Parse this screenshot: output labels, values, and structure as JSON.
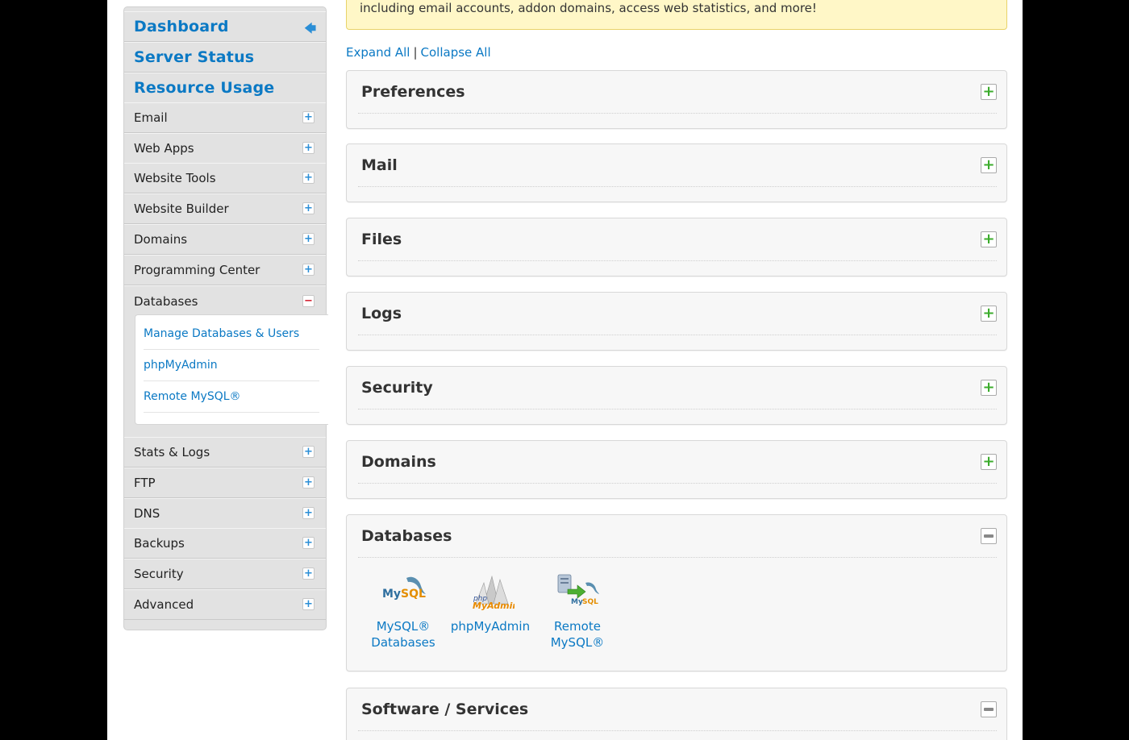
{
  "sidebar": {
    "top_links": [
      {
        "label": "Dashboard",
        "icon": "back-arrow-icon"
      },
      {
        "label": "Server Status"
      },
      {
        "label": "Resource Usage"
      }
    ],
    "sections": [
      {
        "label": "Email",
        "state": "collapsed"
      },
      {
        "label": "Web Apps",
        "state": "collapsed"
      },
      {
        "label": "Website Tools",
        "state": "collapsed"
      },
      {
        "label": "Website Builder",
        "state": "collapsed"
      },
      {
        "label": "Domains",
        "state": "collapsed"
      },
      {
        "label": "Programming Center",
        "state": "collapsed"
      },
      {
        "label": "Databases",
        "state": "expanded"
      },
      {
        "label": "Stats & Logs",
        "state": "collapsed"
      },
      {
        "label": "FTP",
        "state": "collapsed"
      },
      {
        "label": "DNS",
        "state": "collapsed"
      },
      {
        "label": "Backups",
        "state": "collapsed"
      },
      {
        "label": "Security",
        "state": "collapsed"
      },
      {
        "label": "Advanced",
        "state": "collapsed"
      }
    ],
    "databases_sublinks": [
      "Manage Databases & Users",
      "phpMyAdmin",
      "Remote MySQL®"
    ]
  },
  "main": {
    "notice_text": "including email accounts, addon domains, access web statistics, and more!",
    "expand_all": "Expand All",
    "separator": "|",
    "collapse_all": "Collapse All",
    "groups": [
      {
        "title": "Preferences",
        "state": "collapsed"
      },
      {
        "title": "Mail",
        "state": "collapsed"
      },
      {
        "title": "Files",
        "state": "collapsed"
      },
      {
        "title": "Logs",
        "state": "collapsed"
      },
      {
        "title": "Security",
        "state": "collapsed"
      },
      {
        "title": "Domains",
        "state": "collapsed"
      },
      {
        "title": "Databases",
        "state": "expanded",
        "apps": [
          {
            "label_line1": "MySQL®",
            "label_line2": "Databases",
            "icon": "mysql-icon"
          },
          {
            "label_line1": "phpMyAdmin",
            "label_line2": "",
            "icon": "phpmyadmin-icon"
          },
          {
            "label_line1": "Remote",
            "label_line2": "MySQL®",
            "icon": "remote-mysql-icon"
          }
        ]
      },
      {
        "title": "Software / Services",
        "state": "expanded"
      }
    ]
  },
  "colors": {
    "link": "#0b79c4",
    "notice_bg": "#fff7c7",
    "sidebar_bg": "#e2e2e2",
    "plus_green": "#3cac2c",
    "minus_red": "#d11a2a"
  }
}
